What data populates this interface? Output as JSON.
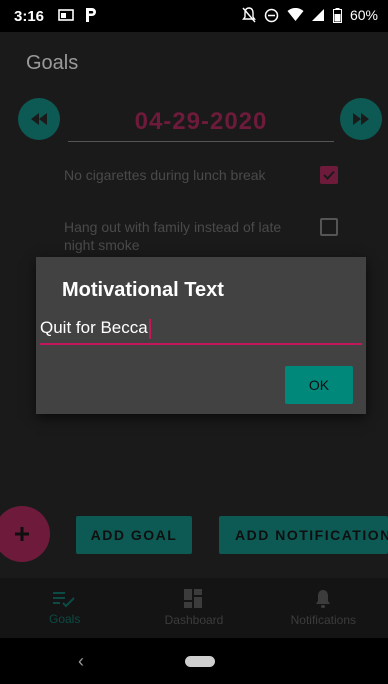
{
  "status_bar": {
    "time": "3:16",
    "battery": "60%",
    "icons": [
      "cast-icon",
      "parking-icon",
      "notifications-off-icon",
      "do-not-disturb-icon",
      "wifi-icon",
      "signal-icon",
      "battery-icon"
    ]
  },
  "app": {
    "title": "Goals",
    "date": "04-29-2020",
    "goals": [
      {
        "text": "No cigarettes during lunch break",
        "checked": true
      },
      {
        "text": "Hang out with family instead of late night smoke",
        "checked": false
      }
    ],
    "fab_label": "+",
    "add_goal_label": "ADD GOAL",
    "add_notification_label": "ADD NOTIFICATION"
  },
  "bottom_nav": {
    "items": [
      {
        "label": "Goals",
        "icon": "goals-list-check-icon",
        "active": true
      },
      {
        "label": "Dashboard",
        "icon": "dashboard-icon",
        "active": false
      },
      {
        "label": "Notifications",
        "icon": "bell-icon",
        "active": false
      }
    ]
  },
  "dialog": {
    "title": "Motivational Text",
    "input_value": "Quit for Becca",
    "ok_label": "OK"
  },
  "system_nav": {
    "back_icon": "back-chevron-icon",
    "home_icon": "home-pill-icon"
  },
  "colors": {
    "accent_teal": "#00897b",
    "accent_pink": "#c2185b",
    "background": "#1a1a1a",
    "dialog_background": "#424242"
  }
}
